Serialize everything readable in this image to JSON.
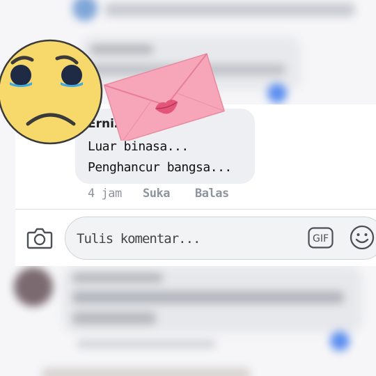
{
  "comment": {
    "author": "Erni…nas",
    "lines": [
      "Luar binasa...",
      "Penghancur bangsa..."
    ],
    "time": "4 jam",
    "like_label": "Suka",
    "reply_label": "Balas"
  },
  "composer": {
    "placeholder": "Tulis komentar...",
    "gif_label": "GIF"
  },
  "icons": {
    "camera": "camera-icon",
    "gif": "gif-icon",
    "emoji": "smiley-icon",
    "sticker_sad": "sad-face-emoji",
    "sticker_envelope": "love-letter-icon"
  },
  "colors": {
    "bubble": "#eeeff2",
    "meta_text": "#8d949e",
    "envelope": "#f7a5b8",
    "emoji_face": "#f6d86b"
  }
}
